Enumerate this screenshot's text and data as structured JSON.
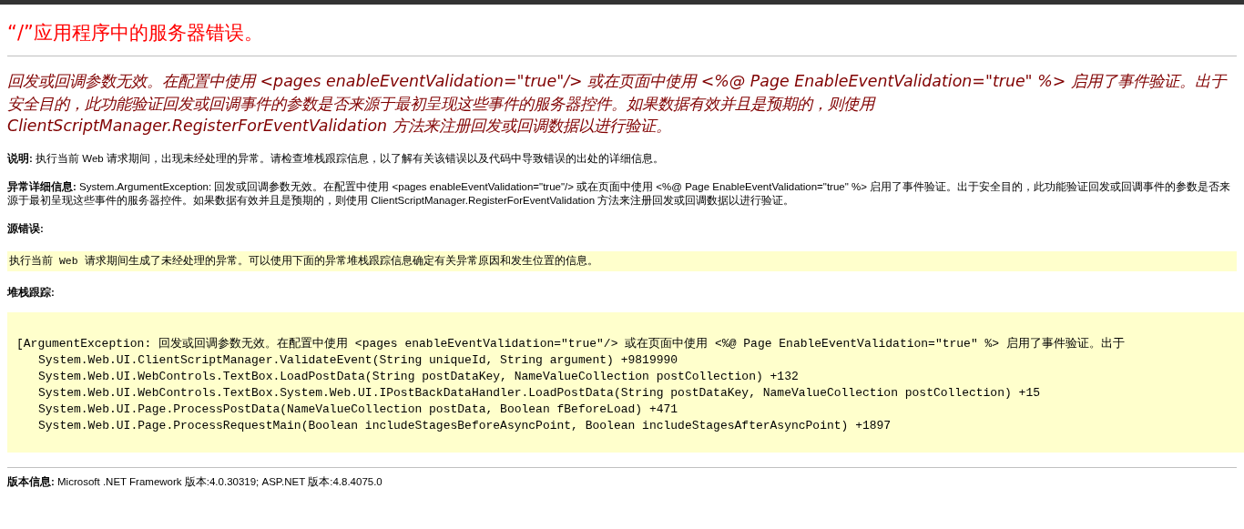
{
  "title": "“/”应用程序中的服务器错误。",
  "message": "回发或回调参数无效。在配置中使用 <pages enableEventValidation=\"true\"/> 或在页面中使用 <%@ Page EnableEventValidation=\"true\" %> 启用了事件验证。出于安全目的，此功能验证回发或回调事件的参数是否来源于最初呈现这些事件的服务器控件。如果数据有效并且是预期的，则使用 ClientScriptManager.RegisterForEventValidation 方法来注册回发或回调数据以进行验证。",
  "description": "**说明:** 执行当前 Web 请求期间，出现未经处理的异常。请检查堆栈跟踪信息，以了解有关该错误以及代码中导致错误的出处的详细信息。",
  "exception_details": "**异常详细信息:** System.ArgumentException: 回发或回调参数无效。在配置中使用 <pages enableEventValidation=\"true\"/> 或在页面中使用 <%@ Page EnableEventValidation=\"true\" %> 启用了事件验证。出于安全目的，此功能验证回发或回调事件的参数是否来源于最初呈现这些事件的服务器控件。如果数据有效并且是预期的，则使用 ClientScriptManager.RegisterForEventValidation 方法来注册回发或回调数据以进行验证。",
  "source_error": {
    "label": "源错误:",
    "code": "执行当前 Web 请求期间生成了未经处理的异常。可以使用下面的异常堆栈跟踪信息确定有关异常原因和发生位置的信息。"
  },
  "stack_trace": {
    "label": "堆栈跟踪:",
    "lines": [
      {
        "kind": "exception",
        "text": "[ArgumentException: 回发或回调参数无效。在配置中使用 <pages enableEventValidation=\"true\"/> 或在页面中使用 <%@ Page EnableEventValidation=\"true\" %> 启用了事件验证。出于"
      },
      {
        "kind": "frame",
        "text": "System.Web.UI.ClientScriptManager.ValidateEvent(String uniqueId, String argument) +9819990"
      },
      {
        "kind": "frame",
        "text": "System.Web.UI.WebControls.TextBox.LoadPostData(String postDataKey, NameValueCollection postCollection) +132"
      },
      {
        "kind": "frame",
        "text": "System.Web.UI.WebControls.TextBox.System.Web.UI.IPostBackDataHandler.LoadPostData(String postDataKey, NameValueCollection postCollection) +15"
      },
      {
        "kind": "frame",
        "text": "System.Web.UI.Page.ProcessPostData(NameValueCollection postData, Boolean fBeforeLoad) +471"
      },
      {
        "kind": "frame",
        "text": "System.Web.UI.Page.ProcessRequestMain(Boolean includeStagesBeforeAsyncPoint, Boolean includeStagesAfterAsyncPoint) +1897"
      }
    ]
  },
  "version": "**版本信息:** Microsoft .NET Framework 版本:4.0.30319; ASP.NET 版本:4.8.4075.0"
}
